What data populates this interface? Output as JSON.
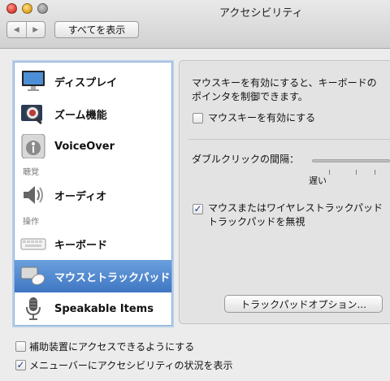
{
  "window": {
    "title": "アクセシビリティ"
  },
  "toolbar": {
    "back_icon": "◀",
    "forward_icon": "▶",
    "show_all_label": "すべてを表示"
  },
  "sidebar": {
    "items": [
      {
        "label": "ディスプレイ",
        "icon": "display-icon"
      },
      {
        "label": "ズーム機能",
        "icon": "zoom-icon"
      },
      {
        "label": "VoiceOver",
        "icon": "voiceover-icon"
      },
      {
        "label": "オーディオ",
        "icon": "speaker-icon"
      },
      {
        "label": "キーボード",
        "icon": "keyboard-icon"
      },
      {
        "label": "マウスとトラックパッド",
        "icon": "mouse-trackpad-icon",
        "selected": true
      },
      {
        "label": "Speakable Items",
        "icon": "microphone-icon"
      }
    ],
    "sections": {
      "hearing": "聴覚",
      "interaction": "操作"
    }
  },
  "panel": {
    "description_line1": "マウスキーを有効にすると、キーボードの",
    "description_line2": "ポインタを制御できます。",
    "mouse_keys_label": "マウスキーを有効にする",
    "double_click_label": "ダブルクリックの間隔：",
    "slow_label": "遅い",
    "ignore_trackpad_line1": "マウスまたはワイヤレストラックパッド",
    "ignore_trackpad_line2": "トラックパッドを無視",
    "ignore_trackpad_checked": true,
    "mouse_keys_checked": false,
    "trackpad_options_label": "トラックパッドオプション..."
  },
  "bottom": {
    "assistive_label": "補助装置にアクセスできるようにする",
    "assistive_checked": false,
    "menubar_label": "メニューバーにアクセシビリティの状況を表示",
    "menubar_checked": true
  },
  "colors": {
    "selection": "#3f76c3",
    "check": "#1a3c8f"
  }
}
